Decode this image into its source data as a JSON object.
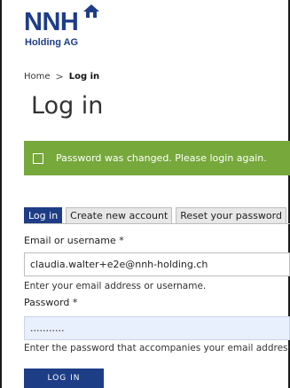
{
  "brand": {
    "name": "NNH",
    "subtitle": "Holding AG",
    "color": "#1d3d86"
  },
  "breadcrumb": {
    "home": "Home",
    "separator": ">",
    "current": "Log in"
  },
  "page_title": "Log in",
  "status": {
    "message": "Password was changed. Please login again.",
    "color": "#77a83b"
  },
  "tabs": [
    {
      "label": "Log in",
      "active": true
    },
    {
      "label": "Create new account",
      "active": false
    },
    {
      "label": "Reset your password",
      "active": false
    }
  ],
  "form": {
    "email_label": "Email or username",
    "email_value": "claudia.walter+e2e@nnh-holding.ch",
    "email_help": "Enter your email address or username.",
    "password_label": "Password",
    "password_value": "...........",
    "password_help": "Enter the password that accompanies your email address.",
    "required_marker": "*",
    "submit_label": "LOG IN"
  }
}
